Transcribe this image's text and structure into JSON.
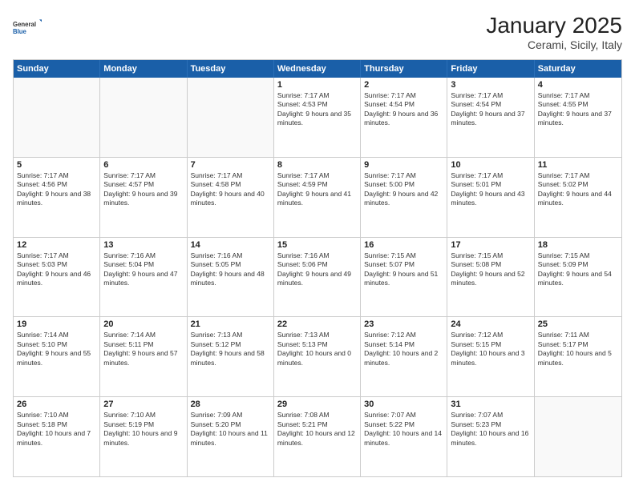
{
  "logo": {
    "general": "General",
    "blue": "Blue"
  },
  "title": "January 2025",
  "subtitle": "Cerami, Sicily, Italy",
  "days_of_week": [
    "Sunday",
    "Monday",
    "Tuesday",
    "Wednesday",
    "Thursday",
    "Friday",
    "Saturday"
  ],
  "weeks": [
    [
      {
        "day": "",
        "text": ""
      },
      {
        "day": "",
        "text": ""
      },
      {
        "day": "",
        "text": ""
      },
      {
        "day": "1",
        "text": "Sunrise: 7:17 AM\nSunset: 4:53 PM\nDaylight: 9 hours and 35 minutes."
      },
      {
        "day": "2",
        "text": "Sunrise: 7:17 AM\nSunset: 4:54 PM\nDaylight: 9 hours and 36 minutes."
      },
      {
        "day": "3",
        "text": "Sunrise: 7:17 AM\nSunset: 4:54 PM\nDaylight: 9 hours and 37 minutes."
      },
      {
        "day": "4",
        "text": "Sunrise: 7:17 AM\nSunset: 4:55 PM\nDaylight: 9 hours and 37 minutes."
      }
    ],
    [
      {
        "day": "5",
        "text": "Sunrise: 7:17 AM\nSunset: 4:56 PM\nDaylight: 9 hours and 38 minutes."
      },
      {
        "day": "6",
        "text": "Sunrise: 7:17 AM\nSunset: 4:57 PM\nDaylight: 9 hours and 39 minutes."
      },
      {
        "day": "7",
        "text": "Sunrise: 7:17 AM\nSunset: 4:58 PM\nDaylight: 9 hours and 40 minutes."
      },
      {
        "day": "8",
        "text": "Sunrise: 7:17 AM\nSunset: 4:59 PM\nDaylight: 9 hours and 41 minutes."
      },
      {
        "day": "9",
        "text": "Sunrise: 7:17 AM\nSunset: 5:00 PM\nDaylight: 9 hours and 42 minutes."
      },
      {
        "day": "10",
        "text": "Sunrise: 7:17 AM\nSunset: 5:01 PM\nDaylight: 9 hours and 43 minutes."
      },
      {
        "day": "11",
        "text": "Sunrise: 7:17 AM\nSunset: 5:02 PM\nDaylight: 9 hours and 44 minutes."
      }
    ],
    [
      {
        "day": "12",
        "text": "Sunrise: 7:17 AM\nSunset: 5:03 PM\nDaylight: 9 hours and 46 minutes."
      },
      {
        "day": "13",
        "text": "Sunrise: 7:16 AM\nSunset: 5:04 PM\nDaylight: 9 hours and 47 minutes."
      },
      {
        "day": "14",
        "text": "Sunrise: 7:16 AM\nSunset: 5:05 PM\nDaylight: 9 hours and 48 minutes."
      },
      {
        "day": "15",
        "text": "Sunrise: 7:16 AM\nSunset: 5:06 PM\nDaylight: 9 hours and 49 minutes."
      },
      {
        "day": "16",
        "text": "Sunrise: 7:15 AM\nSunset: 5:07 PM\nDaylight: 9 hours and 51 minutes."
      },
      {
        "day": "17",
        "text": "Sunrise: 7:15 AM\nSunset: 5:08 PM\nDaylight: 9 hours and 52 minutes."
      },
      {
        "day": "18",
        "text": "Sunrise: 7:15 AM\nSunset: 5:09 PM\nDaylight: 9 hours and 54 minutes."
      }
    ],
    [
      {
        "day": "19",
        "text": "Sunrise: 7:14 AM\nSunset: 5:10 PM\nDaylight: 9 hours and 55 minutes."
      },
      {
        "day": "20",
        "text": "Sunrise: 7:14 AM\nSunset: 5:11 PM\nDaylight: 9 hours and 57 minutes."
      },
      {
        "day": "21",
        "text": "Sunrise: 7:13 AM\nSunset: 5:12 PM\nDaylight: 9 hours and 58 minutes."
      },
      {
        "day": "22",
        "text": "Sunrise: 7:13 AM\nSunset: 5:13 PM\nDaylight: 10 hours and 0 minutes."
      },
      {
        "day": "23",
        "text": "Sunrise: 7:12 AM\nSunset: 5:14 PM\nDaylight: 10 hours and 2 minutes."
      },
      {
        "day": "24",
        "text": "Sunrise: 7:12 AM\nSunset: 5:15 PM\nDaylight: 10 hours and 3 minutes."
      },
      {
        "day": "25",
        "text": "Sunrise: 7:11 AM\nSunset: 5:17 PM\nDaylight: 10 hours and 5 minutes."
      }
    ],
    [
      {
        "day": "26",
        "text": "Sunrise: 7:10 AM\nSunset: 5:18 PM\nDaylight: 10 hours and 7 minutes."
      },
      {
        "day": "27",
        "text": "Sunrise: 7:10 AM\nSunset: 5:19 PM\nDaylight: 10 hours and 9 minutes."
      },
      {
        "day": "28",
        "text": "Sunrise: 7:09 AM\nSunset: 5:20 PM\nDaylight: 10 hours and 11 minutes."
      },
      {
        "day": "29",
        "text": "Sunrise: 7:08 AM\nSunset: 5:21 PM\nDaylight: 10 hours and 12 minutes."
      },
      {
        "day": "30",
        "text": "Sunrise: 7:07 AM\nSunset: 5:22 PM\nDaylight: 10 hours and 14 minutes."
      },
      {
        "day": "31",
        "text": "Sunrise: 7:07 AM\nSunset: 5:23 PM\nDaylight: 10 hours and 16 minutes."
      },
      {
        "day": "",
        "text": ""
      }
    ]
  ]
}
